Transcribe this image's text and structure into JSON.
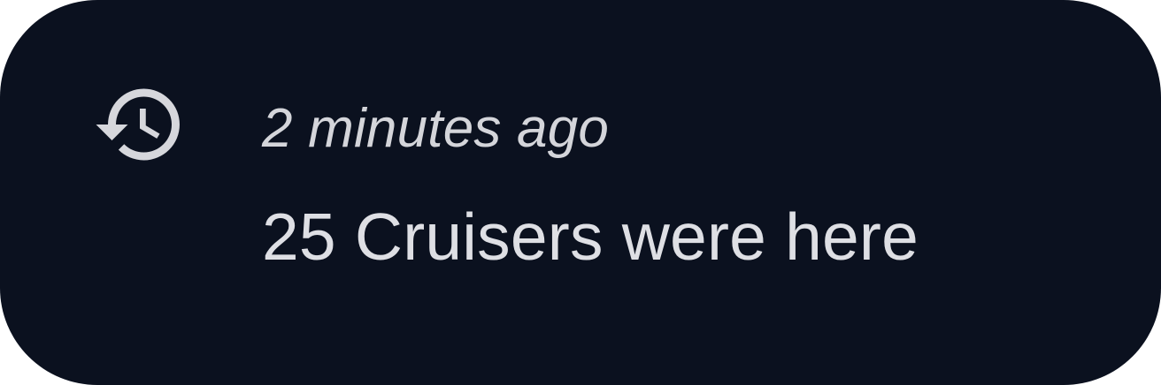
{
  "notice": {
    "icon": "history-icon",
    "time_ago": "2 minutes ago",
    "message": "25 Cruisers were here"
  },
  "colors": {
    "card_background": "#0b111f",
    "text": "#dedfe4",
    "icon": "#d6d7dc"
  }
}
